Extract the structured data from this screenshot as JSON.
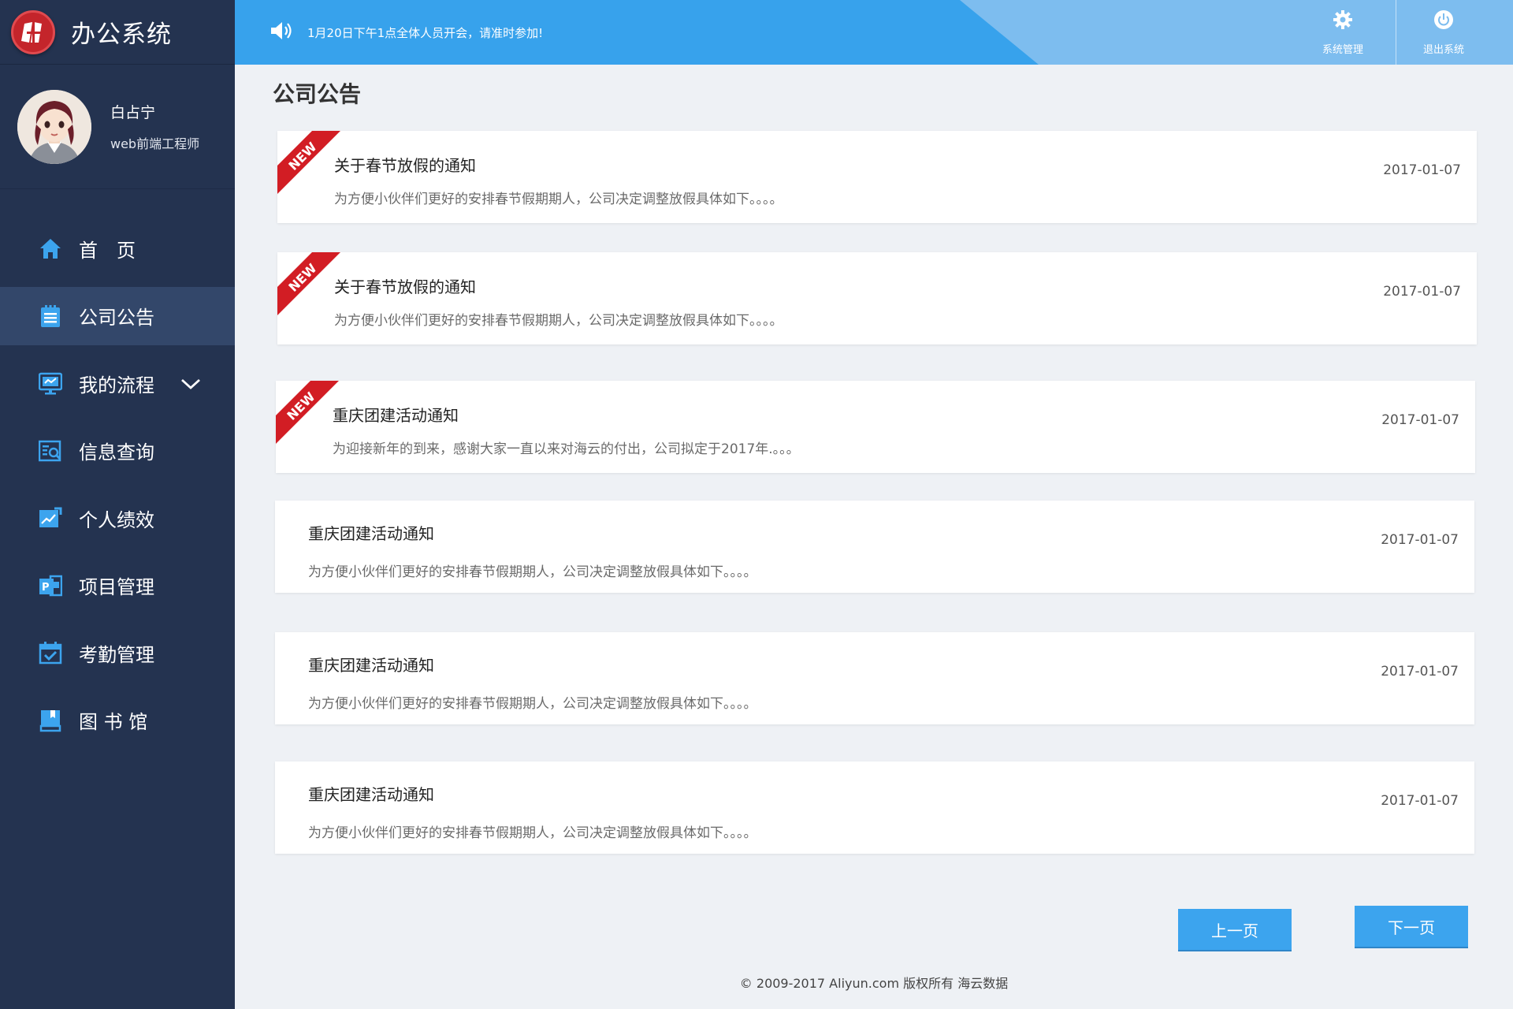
{
  "brand": {
    "title": "办公系统"
  },
  "user": {
    "name": "白占宁",
    "role": "web前端工程师"
  },
  "nav": [
    {
      "label": "首　页",
      "icon": "home-icon"
    },
    {
      "label": "公司公告",
      "icon": "notice-board-icon",
      "active": true
    },
    {
      "label": "我的流程",
      "icon": "workflow-icon",
      "expandable": true
    },
    {
      "label": "信息查询",
      "icon": "search-document-icon"
    },
    {
      "label": "个人绩效",
      "icon": "performance-chart-icon"
    },
    {
      "label": "项目管理",
      "icon": "project-icon"
    },
    {
      "label": "考勤管理",
      "icon": "calendar-check-icon"
    },
    {
      "label": "图 书 馆",
      "icon": "book-icon"
    }
  ],
  "topbar": {
    "notice": "1月20日下午1点全体人员开会，请准时参加!",
    "system_settings": "系统管理",
    "logout": "退出系统",
    "colors": {
      "primary": "#37a2ec",
      "secondary": "#7dbdef"
    }
  },
  "page": {
    "title": "公司公告"
  },
  "announcements": [
    {
      "title": "关于春节放假的通知",
      "desc": "为方便小伙伴们更好的安排春节假期期人，公司决定调整放假具体如下。。。。",
      "date": "2017-01-07",
      "is_new": true,
      "badge": "NEW"
    },
    {
      "title": "关于春节放假的通知",
      "desc": "为方便小伙伴们更好的安排春节假期期人，公司决定调整放假具体如下。。。。",
      "date": "2017-01-07",
      "is_new": true,
      "badge": "NEW"
    },
    {
      "title": "重庆团建活动通知",
      "desc": "为迎接新年的到来，感谢大家一直以来对海云的付出，公司拟定于2017年.。。。",
      "date": "2017-01-07",
      "is_new": true,
      "badge": "NEW"
    },
    {
      "title": "重庆团建活动通知",
      "desc": "为方便小伙伴们更好的安排春节假期期人，公司决定调整放假具体如下。。。。",
      "date": "2017-01-07",
      "is_new": false
    },
    {
      "title": "重庆团建活动通知",
      "desc": "为方便小伙伴们更好的安排春节假期期人，公司决定调整放假具体如下。。。。",
      "date": "2017-01-07",
      "is_new": false
    },
    {
      "title": "重庆团建活动通知",
      "desc": "为方便小伙伴们更好的安排春节假期期人，公司决定调整放假具体如下。。。。",
      "date": "2017-01-07",
      "is_new": false
    }
  ],
  "pagination": {
    "prev": "上一页",
    "next": "下一页"
  },
  "footer": {
    "text": "© 2009-2017 Aliyun.com 版权所有 海云数据"
  }
}
